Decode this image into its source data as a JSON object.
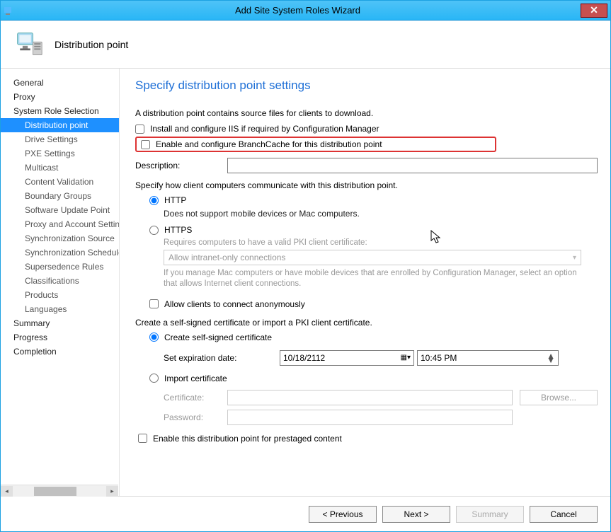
{
  "window": {
    "title": "Add Site System Roles Wizard"
  },
  "header": {
    "page": "Distribution point"
  },
  "nav": {
    "items": [
      {
        "label": "General",
        "sub": false
      },
      {
        "label": "Proxy",
        "sub": false
      },
      {
        "label": "System Role Selection",
        "sub": false
      },
      {
        "label": "Distribution point",
        "sub": true,
        "selected": true
      },
      {
        "label": "Drive Settings",
        "sub": true
      },
      {
        "label": "PXE Settings",
        "sub": true
      },
      {
        "label": "Multicast",
        "sub": true
      },
      {
        "label": "Content Validation",
        "sub": true
      },
      {
        "label": "Boundary Groups",
        "sub": true
      },
      {
        "label": "Software Update Point",
        "sub": true
      },
      {
        "label": "Proxy and Account Settings",
        "sub": true
      },
      {
        "label": "Synchronization Source",
        "sub": true
      },
      {
        "label": "Synchronization Schedule",
        "sub": true
      },
      {
        "label": "Supersedence Rules",
        "sub": true
      },
      {
        "label": "Classifications",
        "sub": true
      },
      {
        "label": "Products",
        "sub": true
      },
      {
        "label": "Languages",
        "sub": true
      },
      {
        "label": "Summary",
        "sub": false
      },
      {
        "label": "Progress",
        "sub": false
      },
      {
        "label": "Completion",
        "sub": false
      }
    ]
  },
  "content": {
    "heading": "Specify distribution point settings",
    "intro": "A distribution point contains source files for clients to download.",
    "chk_iis": "Install and configure IIS if required by Configuration Manager",
    "chk_branch": "Enable and configure BranchCache for this distribution point",
    "desc_label": "Description:",
    "desc_value": "",
    "comm_label": "Specify how client computers communicate with this distribution point.",
    "http_label": "HTTP",
    "http_note": "Does not support mobile devices or Mac computers.",
    "https_label": "HTTPS",
    "https_note": "Requires computers to have a valid PKI client certificate:",
    "https_select": "Allow intranet-only connections",
    "https_hint": "If you manage Mac computers or have mobile devices that are enrolled by Configuration Manager, select an option that allows Internet client connections.",
    "chk_anon": "Allow clients to connect anonymously",
    "cert_intro": "Create a self-signed certificate or import a PKI client certificate.",
    "cert_create": "Create self-signed certificate",
    "exp_label": "Set expiration date:",
    "exp_date": "10/18/2112",
    "exp_time": "10:45 PM",
    "cert_import": "Import certificate",
    "cert_cert_label": "Certificate:",
    "cert_pass_label": "Password:",
    "browse_label": "Browse...",
    "chk_prestage": "Enable this distribution point for prestaged content"
  },
  "footer": {
    "previous": "< Previous",
    "next": "Next >",
    "summary": "Summary",
    "cancel": "Cancel"
  }
}
